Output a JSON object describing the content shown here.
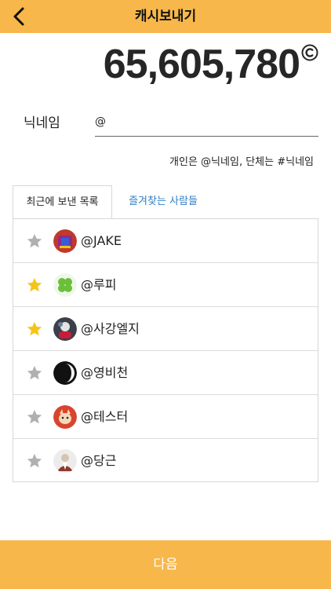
{
  "header": {
    "title": "캐시보내기"
  },
  "balance": {
    "amount": "65,605,780",
    "unit_icon": "cash-c-icon"
  },
  "nickname": {
    "label": "닉네임",
    "value": "@",
    "hint": "개인은 @닉네임, 단체는 #닉네임"
  },
  "tabs": [
    {
      "label": "최근에 보낸 목록",
      "active": true
    },
    {
      "label": "즐겨찾는 사람들",
      "active": false
    }
  ],
  "recipients": [
    {
      "name": "@JAKE",
      "favorite": false,
      "avatar": "cartoon-avatar"
    },
    {
      "name": "@루피",
      "favorite": true,
      "avatar": "clover-avatar"
    },
    {
      "name": "@사강엘지",
      "favorite": true,
      "avatar": "photo-avatar"
    },
    {
      "name": "@영비천",
      "favorite": false,
      "avatar": "photo-avatar"
    },
    {
      "name": "@테스터",
      "favorite": false,
      "avatar": "photo-avatar"
    },
    {
      "name": "@당근",
      "favorite": false,
      "avatar": "photo-avatar"
    }
  ],
  "colors": {
    "accent": "#f7b74a",
    "star_on": "#f5c516",
    "star_off": "#b0b0b0",
    "link": "#2f7fc4"
  },
  "footer": {
    "next_label": "다음"
  }
}
